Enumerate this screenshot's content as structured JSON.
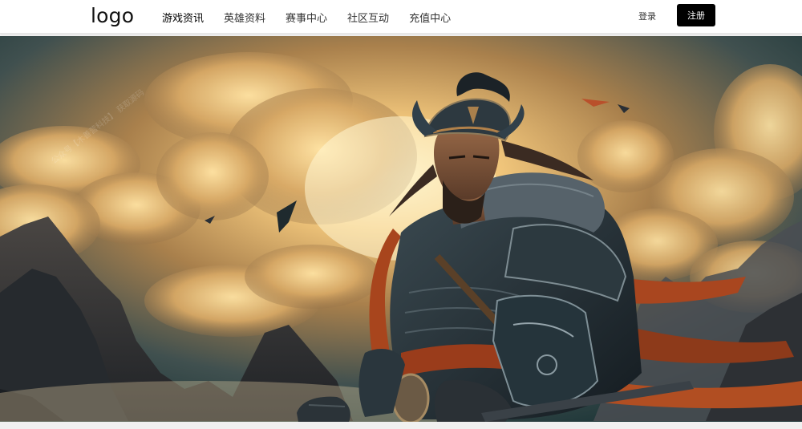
{
  "header": {
    "logo": "logo",
    "nav": [
      {
        "label": "游戏资讯",
        "active": true
      },
      {
        "label": "英雄资料",
        "active": false
      },
      {
        "label": "赛事中心",
        "active": false
      },
      {
        "label": "社区互动",
        "active": false
      },
      {
        "label": "充值中心",
        "active": false
      }
    ],
    "login_label": "登录",
    "register_label": "注册"
  },
  "banner": {
    "image": "ancient-armored-warrior-hero-artwork",
    "watermark": "公众号【木善营科技】 获取源码",
    "slides": 2,
    "active_slide": 1
  },
  "colors": {
    "header_bg": "#ffffff",
    "register_bg": "#000000",
    "page_bg": "#f2f2f2"
  }
}
